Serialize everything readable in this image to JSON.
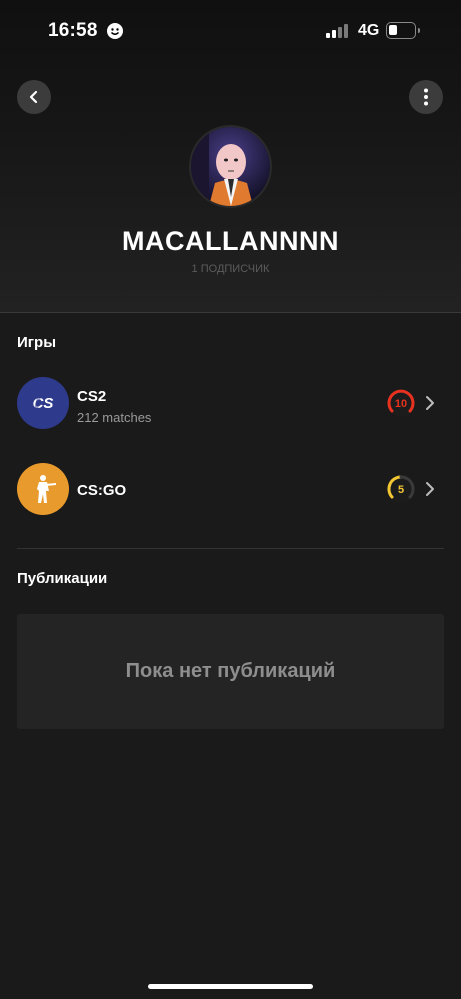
{
  "status_bar": {
    "time": "16:58",
    "network": "4G",
    "battery_level": 0.35
  },
  "profile": {
    "username": "MACALLANNNN",
    "followers": "1 ПОДПИСЧИК"
  },
  "games_section": {
    "title": "Игры",
    "items": [
      {
        "name": "CS2",
        "matches": "212 matches",
        "level": "10",
        "icon": "cs2-logo-icon",
        "level_color": "#e8321f",
        "icon_bg": "#2e3a8c"
      },
      {
        "name": "CS:GO",
        "matches": "",
        "level": "5",
        "icon": "csgo-logo-icon",
        "level_color": "#f3c633",
        "icon_bg": "#e99a2c"
      }
    ]
  },
  "publications_section": {
    "title": "Публикации",
    "empty_text": "Пока нет публикаций"
  }
}
